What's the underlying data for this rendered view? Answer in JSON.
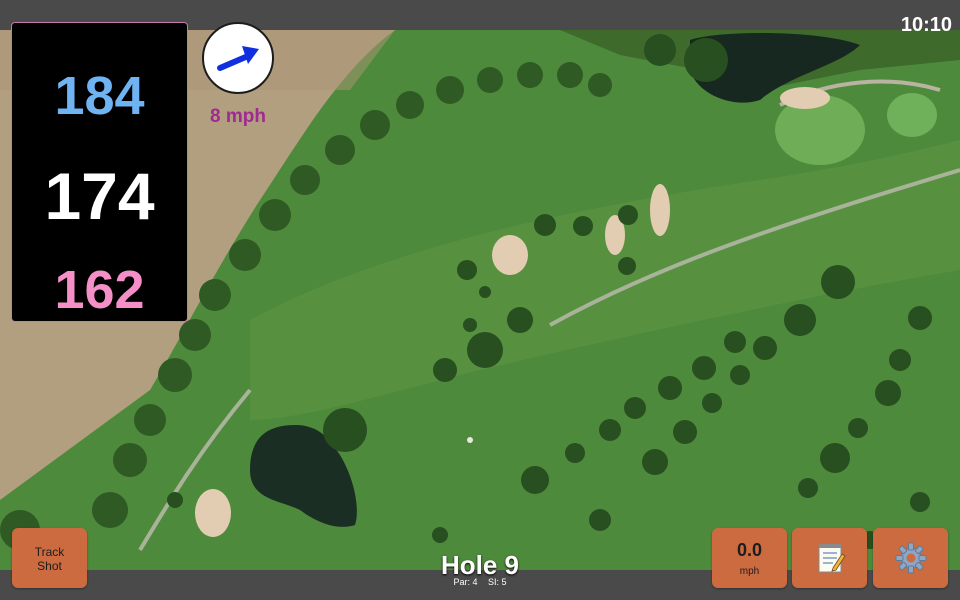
{
  "status_bar": {
    "time": "10:10"
  },
  "distances": {
    "back": "184",
    "middle": "174",
    "front": "162",
    "colors": {
      "back": "#6fb3f2",
      "middle": "#ffffff",
      "front": "#f48fc8"
    }
  },
  "wind": {
    "speed": "8 mph",
    "icon": "wind-direction-arrow-icon",
    "arrow_color": "#1030e0"
  },
  "buttons": {
    "track_shot": {
      "line1": "Track",
      "line2": "Shot"
    },
    "speed": {
      "value": "0.0",
      "unit": "mph"
    },
    "notes": {
      "icon": "notepad-icon"
    },
    "settings": {
      "icon": "gear-icon"
    }
  },
  "hole": {
    "title": "Hole 9",
    "par_label": "Par: 4",
    "si_label": "SI: 5"
  },
  "colors": {
    "button_bg": "#cb6b3f",
    "bar_bg": "#4a4a4a",
    "panel_border": "#c77ab0",
    "wind_text": "#a02a92"
  }
}
